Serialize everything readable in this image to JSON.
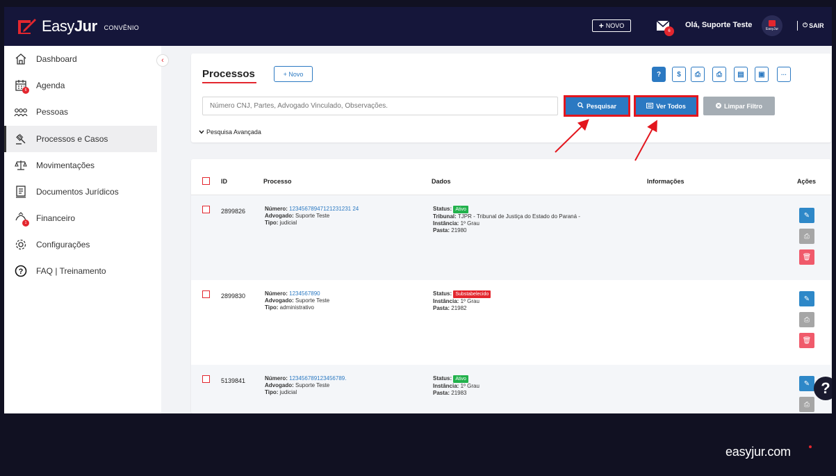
{
  "topbar": {
    "logo_name_light": "Easy",
    "logo_name_bold": "Jur",
    "logo_sub": "CONVÊNIO",
    "novo_label": "NOVO",
    "mail_badge": "6",
    "greeting": "Olá, Suporte Teste",
    "avatar_text": "EasyJur",
    "sair_label": "SAIR"
  },
  "sidebar": {
    "items": [
      {
        "label": "Dashboard",
        "icon": "home-icon"
      },
      {
        "label": "Agenda",
        "icon": "calendar-icon",
        "badge": "6"
      },
      {
        "label": "Pessoas",
        "icon": "people-icon"
      },
      {
        "label": "Processos e Casos",
        "icon": "gavel-icon",
        "active": true
      },
      {
        "label": "Movimentações",
        "icon": "scale-icon"
      },
      {
        "label": "Documentos Jurídicos",
        "icon": "document-icon"
      },
      {
        "label": "Financeiro",
        "icon": "money-icon",
        "badge": "1"
      },
      {
        "label": "Configurações",
        "icon": "gear-icon"
      },
      {
        "label": "FAQ | Treinamento",
        "icon": "question-icon"
      }
    ]
  },
  "processos": {
    "title": "Processos",
    "novo_label": "+ Novo",
    "search_placeholder": "Número CNJ, Partes, Advogado Vinculado, Observações.",
    "pesquisar_label": "Pesquisar",
    "ver_todos_label": "Ver Todos",
    "limpar_label": "Limpar Filtro",
    "advanced_label": "Pesquisa Avançada",
    "toolbar_icons": [
      "help-icon",
      "dollar-icon",
      "print-icon",
      "print-icon",
      "file-icon",
      "excel-icon",
      "more-icon"
    ],
    "toolbar_glyphs": [
      "?",
      "$",
      "⎙",
      "⎙",
      "▤",
      "▣",
      "···"
    ]
  },
  "table": {
    "columns": [
      "ID",
      "Processo",
      "Dados",
      "Informações",
      "Ações"
    ],
    "rows": [
      {
        "id": "2899826",
        "numero_label": "Número:",
        "numero": "12345678947121231231 24",
        "advogado_label": "Advogado:",
        "advogado": "Suporte Teste",
        "tipo_label": "Tipo:",
        "tipo": "judicial",
        "status_label": "Status:",
        "status": "Ativo",
        "tribunal_label": "Tribunal:",
        "tribunal": "TJPR - Tribunal de Justiça do Estado do Paraná -",
        "instancia_label": "Instância:",
        "instancia": "1º Grau",
        "pasta_label": "Pasta:",
        "pasta": "21980"
      },
      {
        "id": "2899830",
        "numero_label": "Número:",
        "numero": "1234567890",
        "advogado_label": "Advogado:",
        "advogado": "Suporte Teste",
        "tipo_label": "Tipo:",
        "tipo": "administrativo",
        "status_label": "Status:",
        "status": "Substabelecido",
        "instancia_label": "Instância:",
        "instancia": "1º Grau",
        "pasta_label": "Pasta:",
        "pasta": "21982"
      },
      {
        "id": "5139841",
        "numero_label": "Número:",
        "numero": "123456789123456789.",
        "advogado_label": "Advogado:",
        "advogado": "Suporte Teste",
        "tipo_label": "Tipo:",
        "tipo": "judicial",
        "status_label": "Status:",
        "status": "Ativo",
        "instancia_label": "Instância:",
        "instancia": "1º Grau",
        "pasta_label": "Pasta:",
        "pasta": "21983"
      }
    ]
  },
  "footer": {
    "brand": "easyjur.com"
  },
  "colors": {
    "topbar": "#15163a",
    "accent_red": "#e3262e",
    "primary_blue": "#2b79c2",
    "status_green": "#22b14c"
  }
}
